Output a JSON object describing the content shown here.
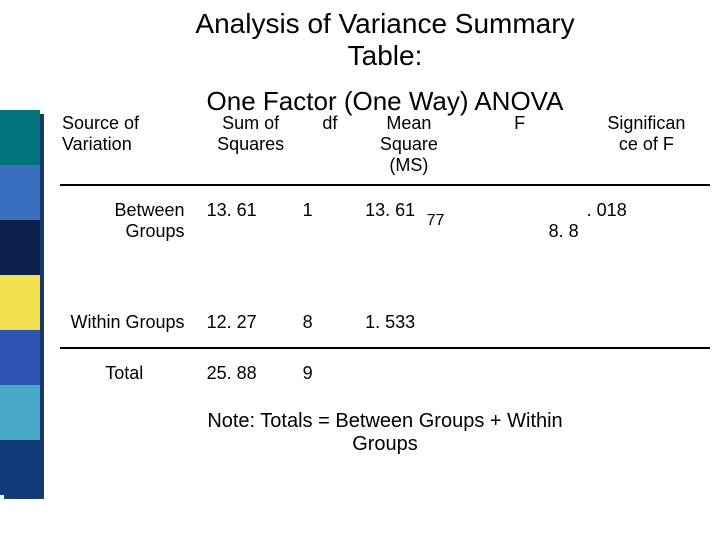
{
  "sidebar": {
    "blocks": 7
  },
  "title_line1": "Analysis of Variance Summary",
  "title_line2": "Table:",
  "subtitle": "One Factor (One Way) ANOVA",
  "headers": {
    "source": "Source of\nVariation",
    "ss": "Sum of\nSquares",
    "df": "df",
    "ms": "Mean\nSquare\n(MS)",
    "f": "F",
    "sig": "Significan\nce of F"
  },
  "rows": {
    "between": {
      "label": "Between\nGroups",
      "ss": "13. 61",
      "df": "1",
      "ms": "13. 61",
      "f": "8. 8",
      "f_sub": "77",
      "sig": ". 018"
    },
    "within": {
      "label": "Within Groups",
      "ss": "12. 27",
      "df": "8",
      "ms": "1. 533",
      "f": "",
      "sig": ""
    },
    "total": {
      "label": "Total",
      "ss": "25. 88",
      "df": "9",
      "ms": "",
      "f": "",
      "sig": ""
    }
  },
  "note_line1": "Note:  Totals = Between Groups + Within",
  "note_line2": "Groups",
  "chart_data": {
    "type": "table",
    "title": "Analysis of Variance Summary Table: One Factor (One Way) ANOVA",
    "columns": [
      "Source of Variation",
      "Sum of Squares",
      "df",
      "Mean Square (MS)",
      "F",
      "Significance of F"
    ],
    "rows": [
      [
        "Between Groups",
        13.61,
        1,
        13.61,
        8.877,
        0.018
      ],
      [
        "Within Groups",
        12.27,
        8,
        1.533,
        null,
        null
      ],
      [
        "Total",
        25.88,
        9,
        null,
        null,
        null
      ]
    ],
    "note": "Totals = Between Groups + Within Groups"
  }
}
